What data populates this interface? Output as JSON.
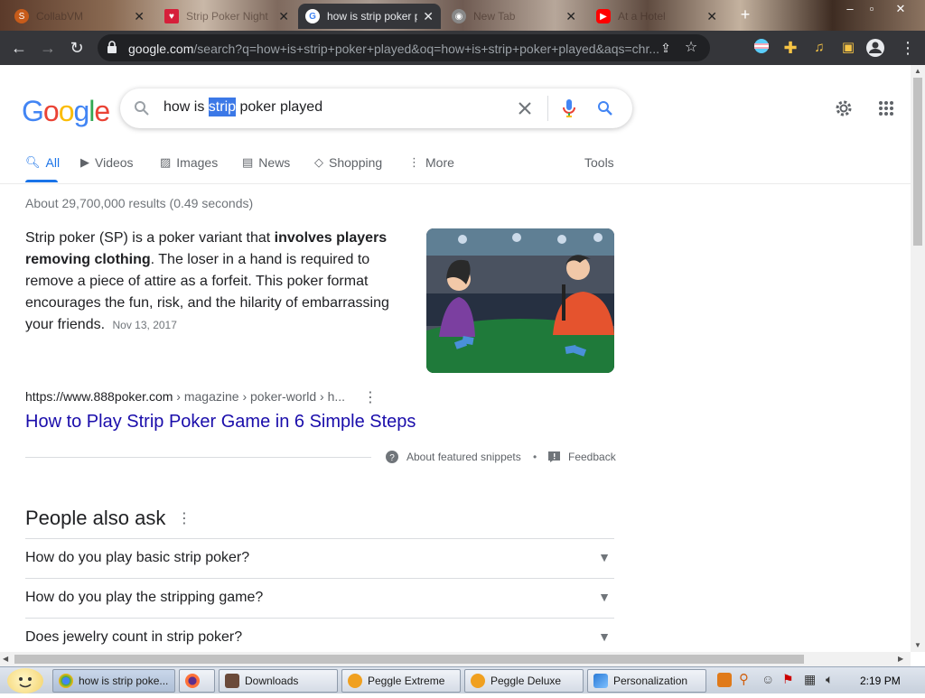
{
  "browser": {
    "tabs": [
      {
        "title": "CollabVM",
        "active": false
      },
      {
        "title": "Strip Poker Night",
        "active": false
      },
      {
        "title": "how is strip poker played",
        "active": true
      },
      {
        "title": "New Tab",
        "active": false
      },
      {
        "title": "At a Hotel",
        "active": false
      }
    ],
    "url_host": "google.com",
    "url_path": "/search?q=how+is+strip+poker+played&oq=how+is+strip+poker+played&aqs=chr..."
  },
  "google": {
    "logo": "Google",
    "query_prefix": "how is ",
    "query_selected": "strip",
    "query_suffix": " poker played",
    "tabs": {
      "all": "All",
      "videos": "Videos",
      "images": "Images",
      "news": "News",
      "shopping": "Shopping",
      "more": "More",
      "tools": "Tools"
    },
    "stats": "About 29,700,000 results (0.49 seconds)",
    "snippet": {
      "t1": "Strip poker (SP) is a poker variant that ",
      "b1": "involves players removing clothing",
      "t2": ". The loser in a hand is required to remove a piece of attire as a forfeit. This poker format encourages the fun, risk, and the hilarity of embarrassing your friends.",
      "date": "Nov 13, 2017"
    },
    "result": {
      "cite_host": "https://www.888poker.com",
      "cite_path": " › magazine › poker-world › h...",
      "title": "How to Play Strip Poker Game in 6 Simple Steps"
    },
    "about_snippets": "About featured snippets",
    "feedback": "Feedback",
    "people_also_ask": {
      "heading": "People also ask",
      "questions": [
        "How do you play basic strip poker?",
        "How do you play the stripping game?",
        "Does jewelry count in strip poker?"
      ]
    }
  },
  "taskbar": {
    "items": [
      {
        "label": "how is strip poke...",
        "active": true
      },
      {
        "label": "",
        "active": false
      },
      {
        "label": "Downloads",
        "active": false
      },
      {
        "label": "Peggle Extreme",
        "active": false
      },
      {
        "label": "Peggle Deluxe",
        "active": false
      },
      {
        "label": "Personalization",
        "active": false
      }
    ],
    "clock": "2:19 PM"
  },
  "colors": {
    "link": "#1a0dab",
    "accent": "#1a73e8",
    "chrome_dark": "#35363a"
  }
}
